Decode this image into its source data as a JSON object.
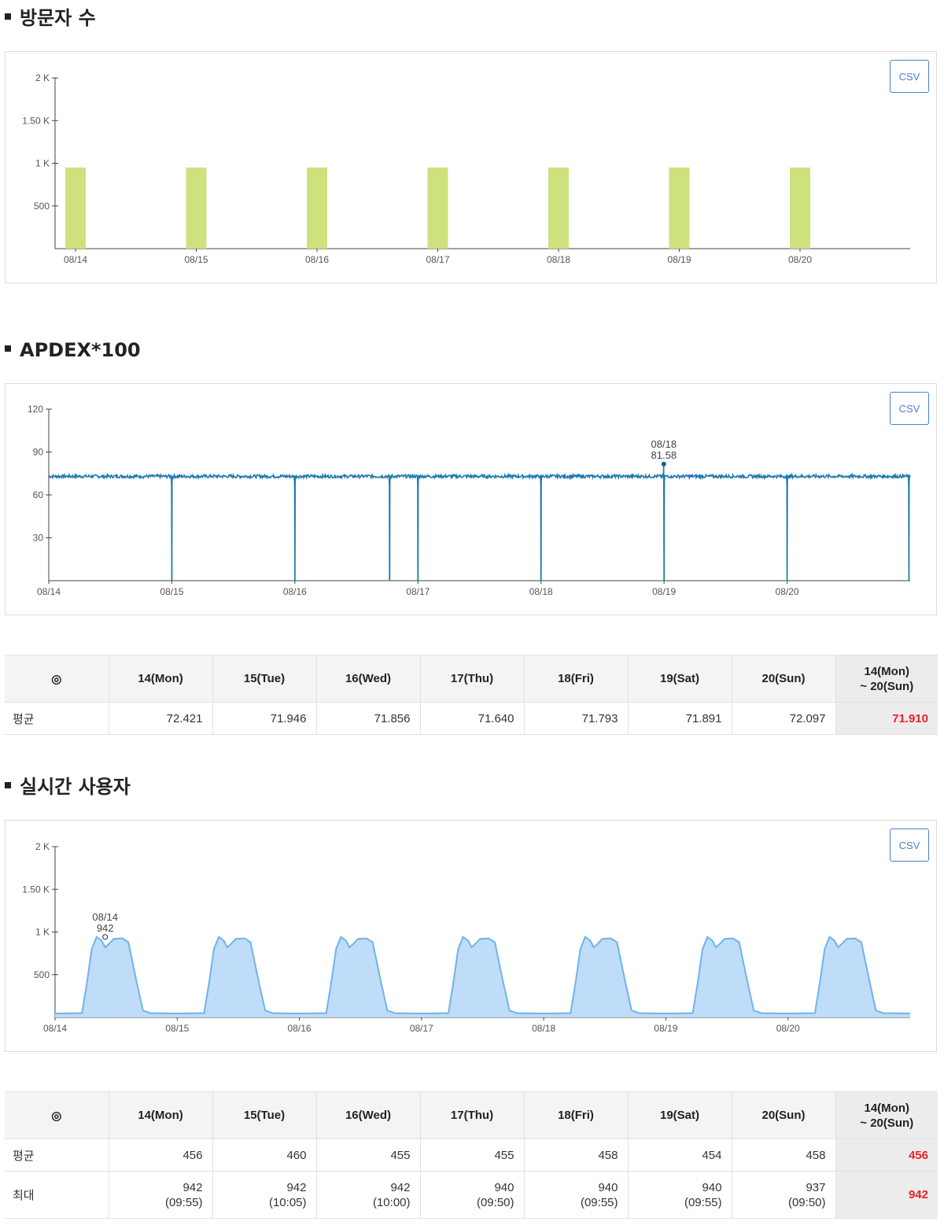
{
  "sections": {
    "visitors": {
      "title": "방문자 수",
      "csv_label": "CSV"
    },
    "apdex": {
      "title": "APDEX*100",
      "csv_label": "CSV"
    },
    "realtime": {
      "title": "실시간 사용자",
      "csv_label": "CSV"
    }
  },
  "chart_data": [
    {
      "type": "bar",
      "categories": [
        "08/14",
        "08/15",
        "08/16",
        "08/17",
        "08/18",
        "08/19",
        "08/20"
      ],
      "values": [
        950,
        950,
        950,
        950,
        950,
        950,
        950
      ],
      "yticks": [
        500,
        1000,
        1500,
        2000
      ],
      "ytick_labels": [
        "500",
        "1 K",
        "1.50 K",
        "2 K"
      ],
      "ylim": [
        0,
        2000
      ],
      "color": "#cde27d",
      "grid": false
    },
    {
      "type": "line",
      "x_ticks": [
        "08/14",
        "08/15",
        "08/16",
        "08/17",
        "08/18",
        "08/19",
        "08/20"
      ],
      "x_range_days": [
        0,
        7
      ],
      "yticks": [
        30,
        60,
        90,
        120
      ],
      "ytick_labels": [
        "30",
        "60",
        "90",
        "120"
      ],
      "ylim": [
        0,
        120
      ],
      "baseline": 73,
      "dips": [
        {
          "day": 1.0,
          "value": 0
        },
        {
          "day": 2.0,
          "value": 0
        },
        {
          "day": 2.77,
          "value": 0
        },
        {
          "day": 3.0,
          "value": 0
        },
        {
          "day": 4.0,
          "value": 0
        },
        {
          "day": 5.0,
          "value": 0
        },
        {
          "day": 6.0,
          "value": 0
        },
        {
          "day": 6.99,
          "value": 0
        }
      ],
      "peak": {
        "day": 4.998,
        "value": 81.58,
        "label_date": "08/18",
        "label_value": "81.58"
      },
      "color": "#1d79ad",
      "grid": false
    },
    {
      "type": "area",
      "x_ticks": [
        "08/14",
        "08/15",
        "08/16",
        "08/17",
        "08/18",
        "08/19",
        "08/20"
      ],
      "x_range_days": [
        0,
        7
      ],
      "yticks": [
        500,
        1000,
        1500,
        2000
      ],
      "ytick_labels": [
        "500",
        "1 K",
        "1.50 K",
        "2 K"
      ],
      "ylim": [
        0,
        2000
      ],
      "daily_profile": [
        [
          0,
          45
        ],
        [
          0.22,
          50
        ],
        [
          0.26,
          400
        ],
        [
          0.3,
          800
        ],
        [
          0.34,
          942
        ],
        [
          0.38,
          900
        ],
        [
          0.41,
          820
        ],
        [
          0.44,
          860
        ],
        [
          0.48,
          920
        ],
        [
          0.55,
          925
        ],
        [
          0.6,
          880
        ],
        [
          0.67,
          400
        ],
        [
          0.72,
          80
        ],
        [
          0.78,
          50
        ],
        [
          1.0,
          45
        ]
      ],
      "peak": {
        "day": 0.41,
        "value": 942,
        "label_date": "08/14",
        "label_value": "942"
      },
      "line_color": "#6eb4ec",
      "fill_color": "#bfdcf8",
      "grid": false
    }
  ],
  "apdex_table": {
    "corner": "◎",
    "headers": [
      "14(Mon)",
      "15(Tue)",
      "16(Wed)",
      "17(Thu)",
      "18(Fri)",
      "19(Sat)",
      "20(Sun)"
    ],
    "total_header_1": "14(Mon)",
    "total_header_2": "~ 20(Sun)",
    "rows": [
      {
        "label": "평균",
        "values": [
          "72.421",
          "71.946",
          "71.856",
          "71.640",
          "71.793",
          "71.891",
          "72.097"
        ],
        "total": "71.910"
      }
    ]
  },
  "realtime_table": {
    "corner": "◎",
    "headers": [
      "14(Mon)",
      "15(Tue)",
      "16(Wed)",
      "17(Thu)",
      "18(Fri)",
      "19(Sat)",
      "20(Sun)"
    ],
    "total_header_1": "14(Mon)",
    "total_header_2": "~ 20(Sun)",
    "avg_row": {
      "label": "평균",
      "values": [
        "456",
        "460",
        "455",
        "455",
        "458",
        "454",
        "458"
      ],
      "total": "456"
    },
    "max_row": {
      "label": "최대",
      "values": [
        "942",
        "942",
        "942",
        "940",
        "940",
        "940",
        "937"
      ],
      "times": [
        "(09:55)",
        "(10:05)",
        "(10:00)",
        "(09:50)",
        "(09:55)",
        "(09:55)",
        "(09:50)"
      ],
      "total": "942"
    }
  },
  "colors": {
    "accent": "#4a7fd1",
    "total_highlight": "#e8212b"
  }
}
